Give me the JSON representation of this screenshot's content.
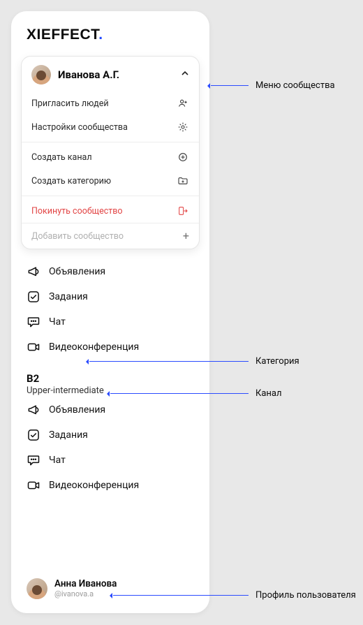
{
  "logo": {
    "text": "XIEFFECT",
    "dot": "."
  },
  "community_menu": {
    "owner": "Иванова А.Г.",
    "items": {
      "invite": "Пригласить людей",
      "settings": "Настройки сообщества",
      "create_channel": "Создать канал",
      "create_category": "Создать категорию",
      "leave": "Покинуть сообщество"
    },
    "add_label": "Добавить сообщество"
  },
  "channels_top": [
    {
      "icon": "megaphone",
      "label": "Объявления"
    },
    {
      "icon": "check",
      "label": "Задания"
    },
    {
      "icon": "chat",
      "label": "Чат"
    },
    {
      "icon": "video",
      "label": "Видеоконференция"
    }
  ],
  "category": {
    "title": "B2",
    "subtitle": "Upper-intermediate"
  },
  "channels_cat": [
    {
      "icon": "megaphone",
      "label": "Объявления"
    },
    {
      "icon": "check",
      "label": "Задания"
    },
    {
      "icon": "chat",
      "label": "Чат"
    },
    {
      "icon": "video",
      "label": "Видеоконференция"
    }
  ],
  "profile": {
    "name": "Анна Иванова",
    "handle": "@ivanova.a"
  },
  "annotations": {
    "menu": "Меню сообщества",
    "category": "Категория",
    "channel": "Канал",
    "profile": "Профиль пользователя"
  }
}
